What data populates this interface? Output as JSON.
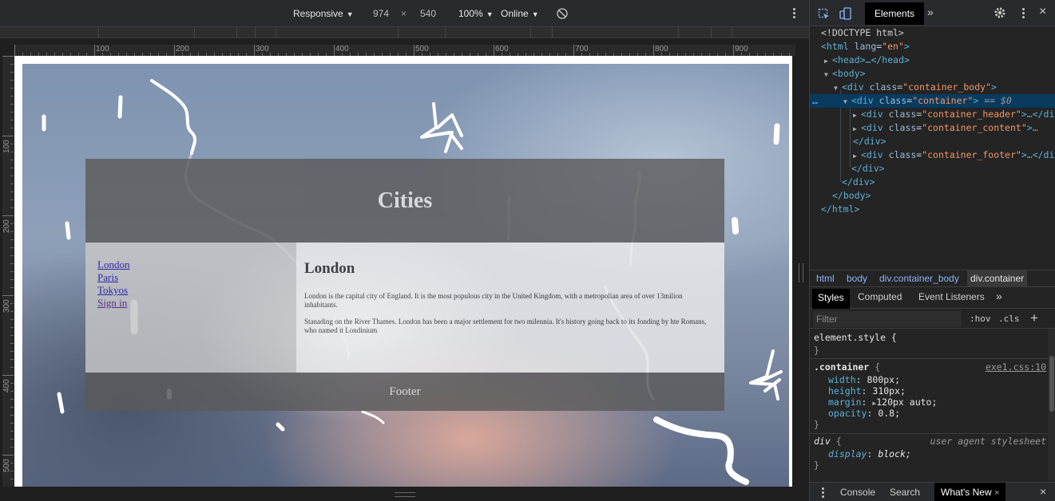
{
  "emulation_toolbar": {
    "device": "Responsive",
    "width": "974",
    "times": "×",
    "height": "540",
    "zoom": "100%",
    "throttle": "Online"
  },
  "ruler": {
    "h_labels": [
      "100",
      "200",
      "300",
      "400",
      "500",
      "600",
      "700",
      "800",
      "900"
    ],
    "v_labels": [
      "100",
      "200",
      "300",
      "400",
      "500"
    ]
  },
  "site": {
    "title": "Cities",
    "nav": [
      "London",
      "Paris",
      "Tokyos",
      "Sign in"
    ],
    "content_title": "London",
    "paragraphs": [
      "London is the capital city of England. It is the most populous city in the United Kingdom, with a metropolian area of over 13milion inhabitants.",
      "Stanading on the River Thames. London has been a major settlement for two milennia. It's history going back to its fonding by hte Romans, who named it Londinium"
    ],
    "footer": "Footer"
  },
  "devtools": {
    "active_tab": "Elements",
    "more_tabs": "»",
    "dom": {
      "doctype": "<!DOCTYPE html>",
      "html_open_tag": "<html",
      "lang_attr": "lang",
      "lang_val": "\"en\"",
      "close_bracket": ">",
      "head": "<head>…</head>",
      "body_open": "<body>",
      "div_open": "<div",
      "class_attr": "class",
      "container_body": "\"container_body\"",
      "container": "\"container\"",
      "selected_suffix": "== $0",
      "container_header": "\"container_header\"",
      "container_content": "\"container_content\"",
      "container_footer": "\"container_footer\"",
      "ellipsis_close": "…</div>",
      "ellipsis": "…",
      "div_close": "</div>",
      "body_close": "</body>",
      "html_close": "</html>",
      "dots": "…"
    },
    "breadcrumbs": [
      "html",
      "body",
      "div.container_body",
      "div.container"
    ],
    "style_tabs": [
      "Styles",
      "Computed",
      "Event Listeners",
      "»"
    ],
    "filter_placeholder": "Filter",
    "hov": ":hov",
    "cls": ".cls",
    "plus": "+",
    "styles": {
      "element_style": "element.style {",
      "close_brace": "}",
      "rule_selector": ".container",
      "open_brace": "{",
      "rule_source": "exe1.css:10",
      "properties": [
        {
          "name": "width",
          "value": "800px;"
        },
        {
          "name": "height",
          "value": "310px;"
        },
        {
          "name": "margin",
          "value": "120px auto;"
        },
        {
          "name": "opacity",
          "value": "0.8;"
        }
      ],
      "ua_selector": "div",
      "ua_source": "user agent stylesheet",
      "ua_prop": "display",
      "ua_value": "block;"
    },
    "drawer_tabs": [
      "Console",
      "Search",
      "What's New"
    ],
    "close": "×"
  }
}
